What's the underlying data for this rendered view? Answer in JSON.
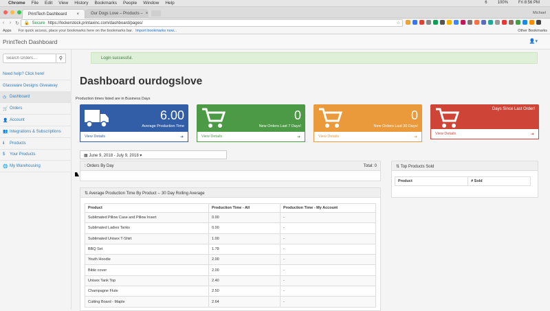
{
  "mac_menu": {
    "apple": "",
    "app": "Chrome",
    "items": [
      "File",
      "Edit",
      "View",
      "History",
      "Bookmarks",
      "People",
      "Window",
      "Help"
    ],
    "status": [
      "6",
      "100%",
      "Fri 8:56 PM"
    ]
  },
  "browser": {
    "tabs": [
      {
        "label": "PrintTech Dashboard",
        "close": "×"
      },
      {
        "label": "Our Dogs Love – Products –",
        "close": "×"
      }
    ],
    "profile": "Michael",
    "secure_label": "Secure",
    "url": "https://lockerstock.printaxinc.com/dashboard/pages/",
    "bookmarks_apps": "Apps",
    "bookmarks_hint": "For quick access, place your bookmarks here on the bookmarks bar.",
    "bookmarks_import": "Import bookmarks now...",
    "other_bookmarks": "Other Bookmarks"
  },
  "header": {
    "brand": "PrintTech Dashboard",
    "user_icon": "user-icon"
  },
  "sidebar": {
    "search_placeholder": "Search Orders...",
    "items": [
      {
        "label": "Need help? Click here!",
        "icon": ""
      },
      {
        "label": "Glassware Designs Giveaway",
        "icon": ""
      },
      {
        "label": "Dashboard",
        "icon": "dashboard-icon"
      },
      {
        "label": "Orders",
        "icon": "cart-icon"
      },
      {
        "label": "Account",
        "icon": "user-icon"
      },
      {
        "label": "Integrations & Subscriptions",
        "icon": "users-icon"
      },
      {
        "label": "Products",
        "icon": "info-icon"
      },
      {
        "label": "Your Products",
        "icon": "dollar-icon"
      },
      {
        "label": "My Warehousing",
        "icon": "globe-icon"
      }
    ]
  },
  "alert": "Login successful.",
  "title": "Dashboard ourdogslove",
  "subtitle": "Production times listed are in Business Days",
  "cards": [
    {
      "value": "6.00",
      "label": "Average Production Time",
      "link": "View Details",
      "color": "#325ea8"
    },
    {
      "value": "0",
      "label": "New Orders Last 7 Days!",
      "link": "View Details",
      "color": "#4c9a45"
    },
    {
      "value": "0",
      "label": "New Orders Last 30 Days!",
      "link": "View Details",
      "color": "#ea9a3a"
    },
    {
      "value": "",
      "label": "Days Since Last Order!",
      "link": "View Details",
      "color": "#ce4537"
    }
  ],
  "daterange": "June 9, 2018 - July 9, 2018",
  "orders_panel": {
    "title": "Orders By Day",
    "total": "Total: 0"
  },
  "top_products": {
    "title": "Top Products Sold",
    "col1": "Product",
    "col2": "# Sold"
  },
  "production_table": {
    "title": "Average Production Time By Product -- 30 Day Rolling Average",
    "headers": [
      "Product",
      "Production Time - All",
      "Production Time - My Account"
    ],
    "rows": [
      [
        "Sublimated Pillow Case and Pillow Insert",
        "0.00",
        "-"
      ],
      [
        "Sublimated Ladies Tanks",
        "0.00",
        "-"
      ],
      [
        "Sublimated Unisex T-Shirt",
        "1.00",
        "-"
      ],
      [
        "BBQ Set",
        "1.78",
        "-"
      ],
      [
        "Youth Hoodie",
        "2.00",
        "-"
      ],
      [
        "Bible cover",
        "2.00",
        "-"
      ],
      [
        "Unisex Tank Top",
        "2.40",
        "-"
      ],
      [
        "Champagne Flute",
        "2.50",
        "-"
      ],
      [
        "Cutting Board - Maple",
        "2.64",
        "-"
      ]
    ]
  }
}
